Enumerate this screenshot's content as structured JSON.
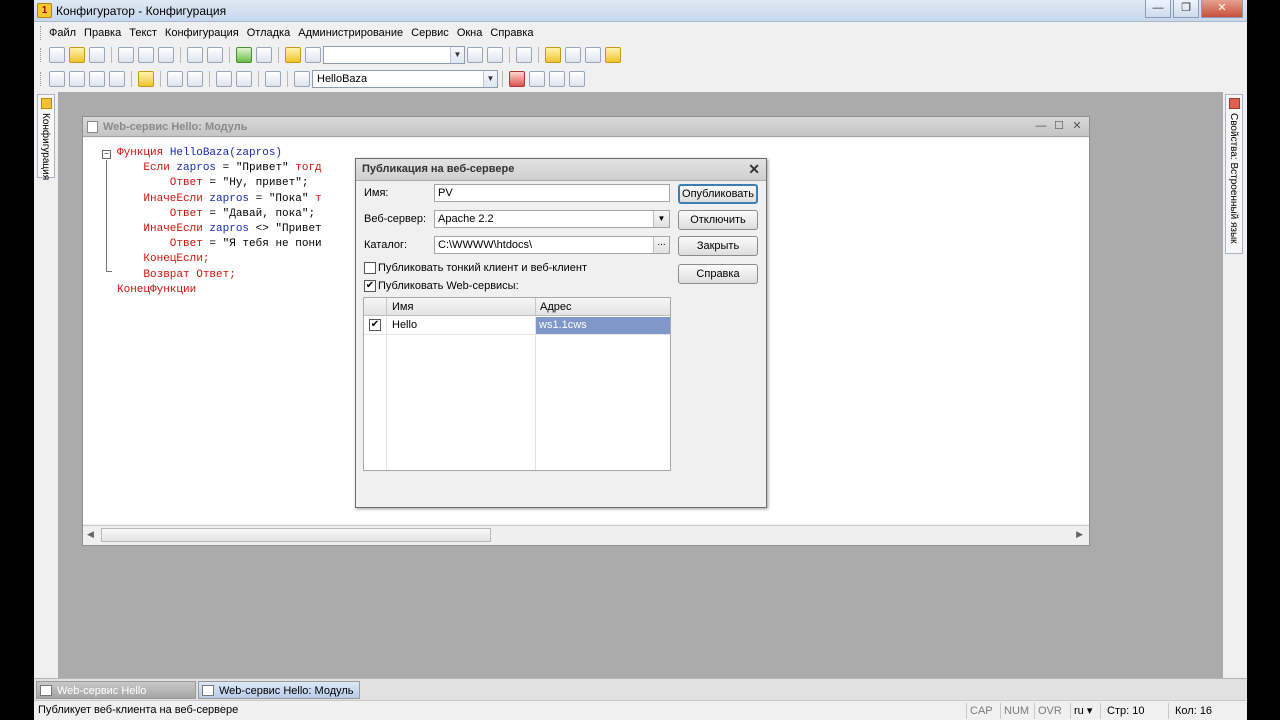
{
  "window": {
    "title": "Конфигуратор - Конфигурация",
    "minimize": "—",
    "restore": "❐",
    "close": "✕"
  },
  "menu": [
    "Файл",
    "Правка",
    "Текст",
    "Конфигурация",
    "Отладка",
    "Администрирование",
    "Сервис",
    "Окна",
    "Справка"
  ],
  "toolbar": {
    "search_value": "",
    "config_combo": "HelloBaza"
  },
  "side_panels": {
    "left_label": "Конфигурация",
    "right_label": "Свойства: Встроенный язык"
  },
  "module_window": {
    "title": "Web-сервис Hello: Модуль",
    "fold_marker": "−",
    "code_lines": [
      [
        {
          "t": "Функция ",
          "c": "kw"
        },
        {
          "t": "HelloBaza(zapros)",
          "c": "id"
        }
      ],
      [
        {
          "t": "    Если ",
          "c": "kw"
        },
        {
          "t": "zapros",
          "c": "id"
        },
        {
          "t": " = \"Привет\" ",
          "c": "txt"
        },
        {
          "t": "тогд",
          "c": "kw"
        }
      ],
      [
        {
          "t": "        Ответ",
          "c": "kw"
        },
        {
          "t": " = \"Ну, привет\";",
          "c": "txt"
        }
      ],
      [
        {
          "t": "    ИначеЕсли ",
          "c": "kw"
        },
        {
          "t": "zapros",
          "c": "id"
        },
        {
          "t": " = \"Пока\" ",
          "c": "txt"
        },
        {
          "t": "т",
          "c": "kw"
        }
      ],
      [
        {
          "t": "        Ответ",
          "c": "kw"
        },
        {
          "t": " = \"Давай, пока\";",
          "c": "txt"
        }
      ],
      [
        {
          "t": "    ИначеЕсли ",
          "c": "kw"
        },
        {
          "t": "zapros",
          "c": "id"
        },
        {
          "t": " <> \"Привет",
          "c": "txt"
        }
      ],
      [
        {
          "t": "        Ответ",
          "c": "kw"
        },
        {
          "t": " = \"Я тебя не пони",
          "c": "txt"
        }
      ],
      [
        {
          "t": "    КонецЕсли;",
          "c": "kw"
        }
      ],
      [
        {
          "t": "    Возврат ",
          "c": "kw"
        },
        {
          "t": "Ответ;",
          "c": "kw"
        }
      ],
      [
        {
          "t": "КонецФункции",
          "c": "kw"
        }
      ]
    ]
  },
  "dialog": {
    "title": "Публикация на веб-сервере",
    "close": "✕",
    "name_label": "Имя:",
    "name_value": "PV",
    "server_label": "Веб-сервер:",
    "server_value": "Apache 2.2",
    "catalog_label": "Каталог:",
    "catalog_value": "C:\\WWWW\\htdocs\\",
    "catalog_browse": "...",
    "thin_client_label": "Публиковать тонкий клиент и веб-клиент",
    "thin_client_checked": false,
    "web_services_label": "Публиковать Web-сервисы:",
    "web_services_checked": true,
    "buttons": {
      "publish": "Опубликовать",
      "disable": "Отключить",
      "close": "Закрыть",
      "help": "Справка"
    },
    "grid": {
      "col_name": "Имя",
      "col_address": "Адрес",
      "rows": [
        {
          "checked": true,
          "name": "Hello",
          "address": "ws1.1cws"
        }
      ]
    }
  },
  "taskbar": {
    "task1": "Web-сервис Hello",
    "task2": "Web-сервис Hello: Модуль"
  },
  "statusbar": {
    "message": "Публикует веб-клиента на веб-сервере",
    "cap": "CAP",
    "num": "NUM",
    "ovr": "OVR",
    "lang": "ru ▾",
    "line": "Стр: 10",
    "col": "Кол: 16"
  }
}
